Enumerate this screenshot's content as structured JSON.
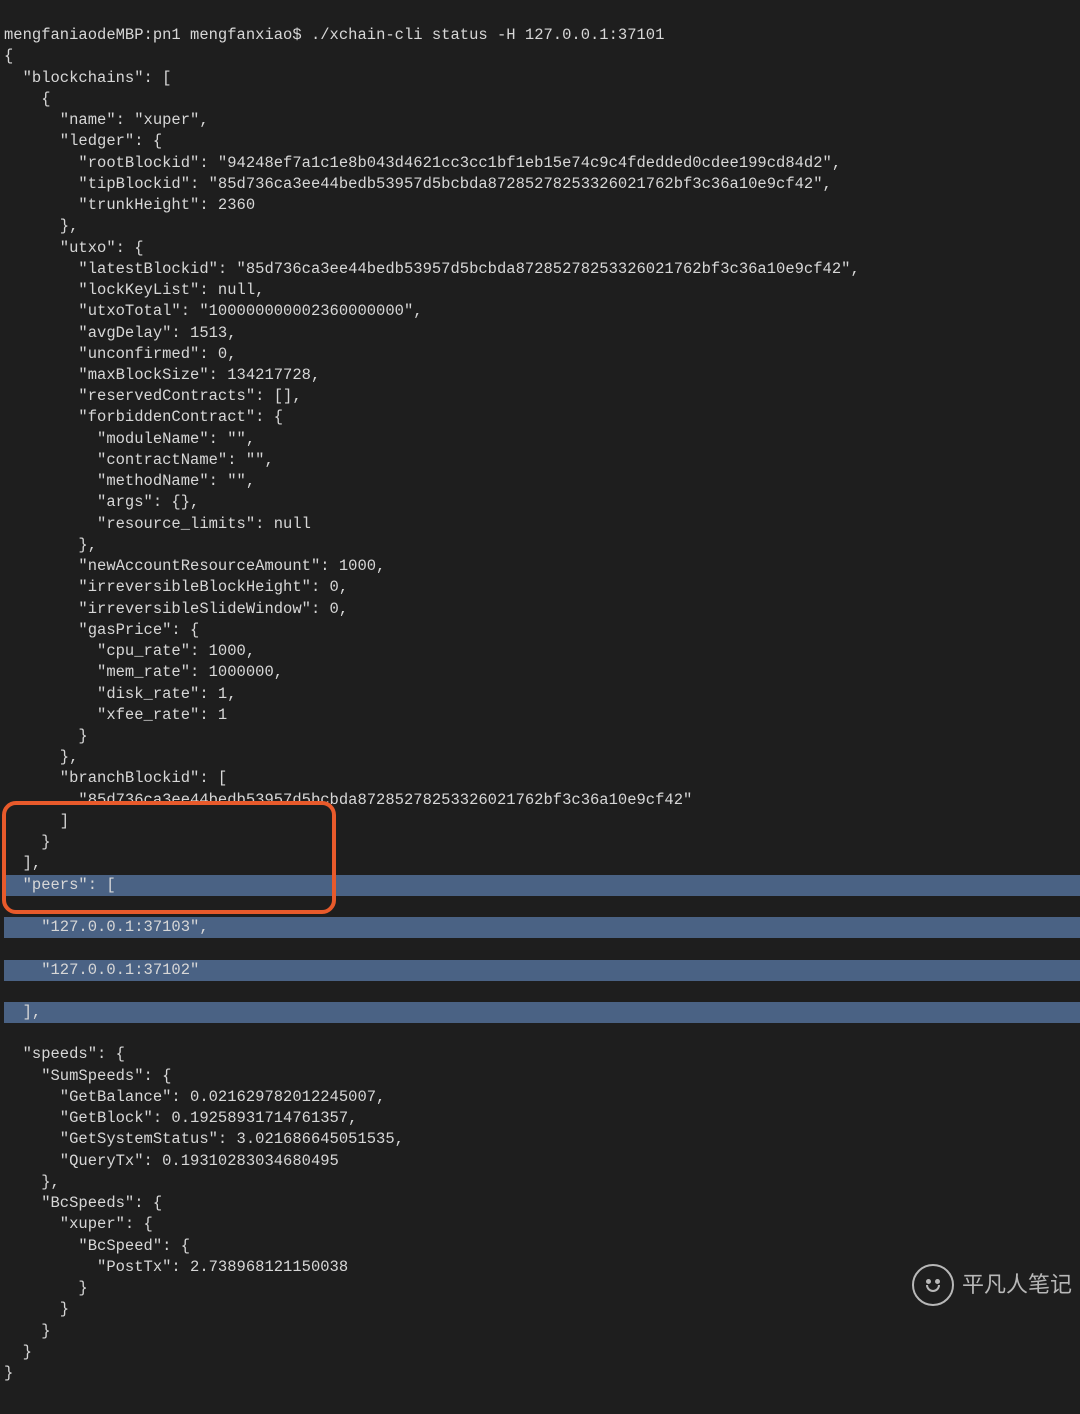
{
  "prompt": {
    "host": "mengfaniaodeMBP:pn1 mengfanxiao$ ",
    "cmd": "./xchain-cli status -H 127.0.0.1:37101"
  },
  "json": {
    "open": "{",
    "blockchains_key": "  \"blockchains\": [",
    "bc_open": "    {",
    "name": "      \"name\": \"xuper\",",
    "ledger_open": "      \"ledger\": {",
    "rootBlockid": "        \"rootBlockid\": \"94248ef7a1c1e8b043d4621cc3cc1bf1eb15e74c9c4fdedded0cdee199cd84d2\",",
    "tipBlockid": "        \"tipBlockid\": \"85d736ca3ee44bedb53957d5bcbda87285278253326021762bf3c36a10e9cf42\",",
    "trunkHeight": "        \"trunkHeight\": 2360",
    "ledger_close": "      },",
    "utxo_open": "      \"utxo\": {",
    "latestBlockid": "        \"latestBlockid\": \"85d736ca3ee44bedb53957d5bcbda87285278253326021762bf3c36a10e9cf42\",",
    "lockKeyList": "        \"lockKeyList\": null,",
    "utxoTotal": "        \"utxoTotal\": \"100000000002360000000\",",
    "avgDelay": "        \"avgDelay\": 1513,",
    "unconfirmed": "        \"unconfirmed\": 0,",
    "maxBlockSize": "        \"maxBlockSize\": 134217728,",
    "reservedContracts": "        \"reservedContracts\": [],",
    "forbidden_open": "        \"forbiddenContract\": {",
    "moduleName": "          \"moduleName\": \"\",",
    "contractName": "          \"contractName\": \"\",",
    "methodName": "          \"methodName\": \"\",",
    "args": "          \"args\": {},",
    "resource_limits": "          \"resource_limits\": null",
    "forbidden_close": "        },",
    "newAccountResourceAmount": "        \"newAccountResourceAmount\": 1000,",
    "irreversibleBlockHeight": "        \"irreversibleBlockHeight\": 0,",
    "irreversibleSlideWindow": "        \"irreversibleSlideWindow\": 0,",
    "gasPrice_open": "        \"gasPrice\": {",
    "cpu_rate": "          \"cpu_rate\": 1000,",
    "mem_rate": "          \"mem_rate\": 1000000,",
    "disk_rate": "          \"disk_rate\": 1,",
    "xfee_rate": "          \"xfee_rate\": 1",
    "gasPrice_close": "        }",
    "utxo_close": "      },",
    "branchBlockid_open": "      \"branchBlockid\": [",
    "branchBlockid_val": "        \"85d736ca3ee44bedb53957d5bcbda87285278253326021762bf3c36a10e9cf42\"",
    "branchBlockid_close": "      ]",
    "bc_close": "    }",
    "blockchains_close": "  ],",
    "peers_open": "  \"peers\": [",
    "peer1": "    \"127.0.0.1:37103\",",
    "peer2": "    \"127.0.0.1:37102\"",
    "peers_close": "  ],",
    "speeds_open": "  \"speeds\": {",
    "sumSpeeds_open": "    \"SumSpeeds\": {",
    "getBalance": "      \"GetBalance\": 0.021629782012245007,",
    "getBlock": "      \"GetBlock\": 0.19258931714761357,",
    "getSystemStatus": "      \"GetSystemStatus\": 3.021686645051535,",
    "queryTx": "      \"QueryTx\": 0.19310283034680495",
    "sumSpeeds_close": "    },",
    "bcSpeeds_open": "    \"BcSpeeds\": {",
    "xuper_open": "      \"xuper\": {",
    "bcSpeed_open": "        \"BcSpeed\": {",
    "postTx": "          \"PostTx\": 2.738968121150038",
    "bcSpeed_close": "        }",
    "xuper_close": "      }",
    "bcSpeeds_close": "    }",
    "speeds_close": "  }",
    "close": "}"
  },
  "watermark": "平凡人笔记"
}
